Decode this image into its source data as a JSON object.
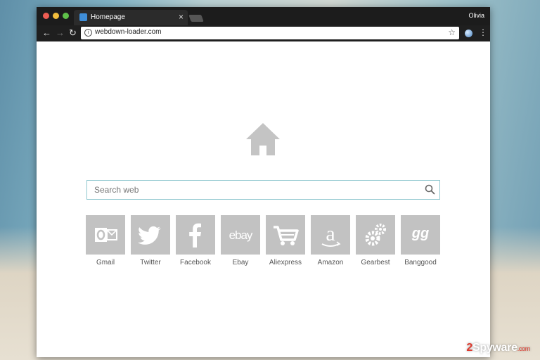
{
  "browser": {
    "tab_title": "Homepage",
    "tab_close": "×",
    "profile_name": "Olivia",
    "url": "webdown-loader.com",
    "icons": {
      "back": "arrow-left-icon",
      "forward": "arrow-right-icon",
      "reload": "reload-icon",
      "info": "info-icon",
      "star": "star-icon",
      "extension": "globe-icon",
      "menu": "more-vert-icon"
    }
  },
  "page": {
    "logo_icon": "home-icon",
    "search": {
      "placeholder": "Search web",
      "icon": "search-icon"
    },
    "shortcuts": [
      {
        "label": "Gmail",
        "icon": "outlook-icon"
      },
      {
        "label": "Twitter",
        "icon": "twitter-icon"
      },
      {
        "label": "Facebook",
        "icon": "facebook-icon"
      },
      {
        "label": "Ebay",
        "icon": "ebay-icon"
      },
      {
        "label": "Aliexpress",
        "icon": "cart-icon"
      },
      {
        "label": "Amazon",
        "icon": "amazon-icon"
      },
      {
        "label": "Gearbest",
        "icon": "gears-icon"
      },
      {
        "label": "Banggood",
        "icon": "banggood-icon"
      }
    ]
  },
  "watermark": {
    "num": "2",
    "brand": "Spyware",
    "suffix": ".com"
  },
  "colors": {
    "tile_bg": "#c2c2c2",
    "search_border": "#8fc7cf",
    "titlebar": "#1c1c1c"
  }
}
